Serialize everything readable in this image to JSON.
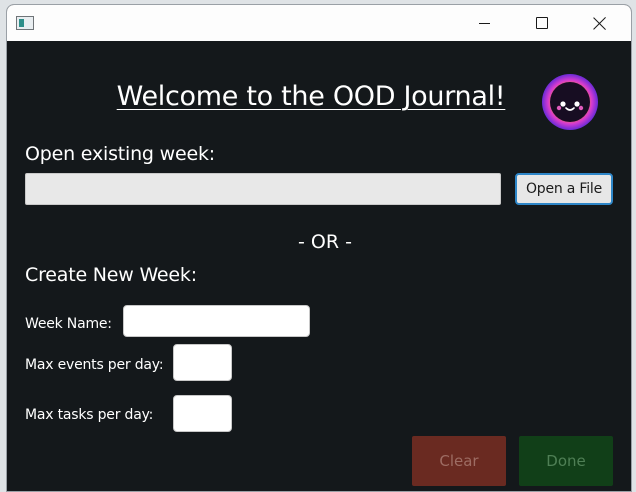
{
  "window": {
    "controls": {
      "minimize": "minimize-icon",
      "maximize": "maximize-icon",
      "close": "close-icon"
    }
  },
  "header": {
    "title": "Welcome to the OOD Journal!",
    "mascot_icon": "smiling-blob-icon"
  },
  "open_section": {
    "label": "Open existing week:",
    "file_path_value": "",
    "open_button_label": "Open a File"
  },
  "divider": {
    "text": "- OR -"
  },
  "create_section": {
    "label": "Create New Week:",
    "week_name_label": "Week Name:",
    "week_name_value": "",
    "max_events_label": "Max events per day:",
    "max_events_value": "",
    "max_tasks_label": "Max tasks per day:",
    "max_tasks_value": ""
  },
  "actions": {
    "clear_label": "Clear",
    "done_label": "Done"
  },
  "colors": {
    "background": "#14181b",
    "clear_button": "#6a2a21",
    "done_button": "#113f18",
    "focus_accent": "#2e86c8"
  }
}
